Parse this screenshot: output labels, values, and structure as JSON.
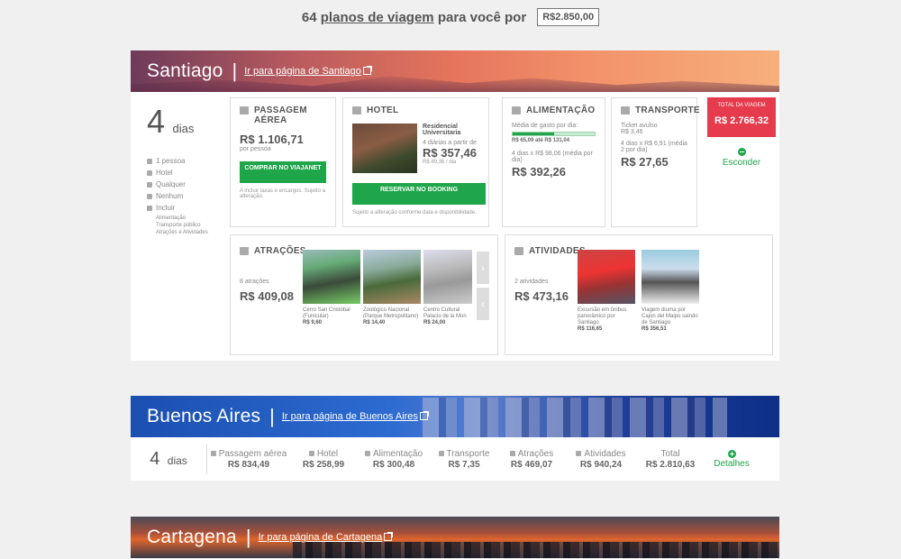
{
  "header": {
    "count": "64",
    "link": "planos de viagem",
    "suffix": "para você por",
    "budget": "R$2.850,00"
  },
  "santiago": {
    "name": "Santiago",
    "link": "Ir para página de Santiago",
    "days": "4",
    "days_label": "dias",
    "filters": [
      "1 pessoa",
      "Hotel",
      "Qualquer",
      "Nenhum",
      "Incluir"
    ],
    "include_items": [
      "Alimentação",
      "Transporte público",
      "Atrações e Atividades"
    ],
    "flight": {
      "title": "PASSAGEM AÉREA",
      "price": "R$ 1.106,71",
      "per": "por pessoa",
      "button": "COMPRAR NO VIAJANET",
      "note": "A incluir taxas e encargos. Sujeito a alteração."
    },
    "hotel": {
      "title": "HOTEL",
      "name": "Residencial Universitaria",
      "nights": "4 diárias a partir de",
      "price": "R$ 357,46",
      "per_day": "R$ 89,36 / dia",
      "button": "RESERVAR NO BOOKING",
      "note": "Sujeito a alteração conforme data e disponibilidade."
    },
    "food": {
      "title": "ALIMENTAÇÃO",
      "avg_label": "Média de gasto por dia:",
      "range": "R$ 65,09 até R$ 131,04",
      "calc": "4 dias x R$ 98,06 (média por dia)",
      "price": "R$ 392,26",
      "level": 0.5
    },
    "transport": {
      "title": "TRANSPORTE",
      "ticket": "Ticket avulso",
      "ticket_price": "R$ 3,46",
      "calc": "4 dias x R$ 6,91 (média 2 por dia)",
      "price": "R$ 27,65"
    },
    "total": {
      "label": "TOTAL DA VIAGEM",
      "value": "R$ 2.766,32",
      "hide": "Esconder"
    },
    "attractions": {
      "title": "ATRAÇÕES",
      "count": "8 atrações",
      "price": "R$ 409,08",
      "items": [
        {
          "name": "Cerro San Cristóbal (Funicular)",
          "price": "R$ 9,60"
        },
        {
          "name": "Zoológico Nacional (Parque Metropolitano)",
          "price": "R$ 14,40"
        },
        {
          "name": "Centro Cultural Palacio de la Mon",
          "price": "R$ 24,00"
        }
      ]
    },
    "activities": {
      "title": "ATIVIDADES",
      "count": "2 atividades",
      "price": "R$ 473,16",
      "items": [
        {
          "name": "Excursão em ônibus panorâmico por Santiago",
          "price": "R$ 116,65"
        },
        {
          "name": "Viagem diurna por Cajon del Maipo saindo de Santiago",
          "price": "R$ 356,51"
        }
      ]
    }
  },
  "buenos_aires": {
    "name": "Buenos Aires",
    "link": "Ir para página de Buenos Aires",
    "days": "4",
    "days_label": "dias",
    "cols": [
      {
        "label": "Passagem aérea",
        "value": "R$ 834,49",
        "icon": "plane-icon"
      },
      {
        "label": "Hotel",
        "value": "R$ 258,99",
        "icon": "bed-icon"
      },
      {
        "label": "Alimentação",
        "value": "R$ 300,48",
        "icon": "cutlery-icon"
      },
      {
        "label": "Transporte",
        "value": "R$ 7,35",
        "icon": "bus-icon"
      },
      {
        "label": "Atrações",
        "value": "R$ 469,07",
        "icon": "museum-icon"
      },
      {
        "label": "Atividades",
        "value": "R$ 940,24",
        "icon": "activity-icon"
      },
      {
        "label": "Total",
        "value": "R$ 2.810,63",
        "icon": ""
      }
    ],
    "details": "Detalhes"
  },
  "cartagena": {
    "name": "Cartagena",
    "link": "Ir para página de Cartagena"
  },
  "colors": {
    "green": "#1fa54a",
    "red": "#e63a4d"
  }
}
